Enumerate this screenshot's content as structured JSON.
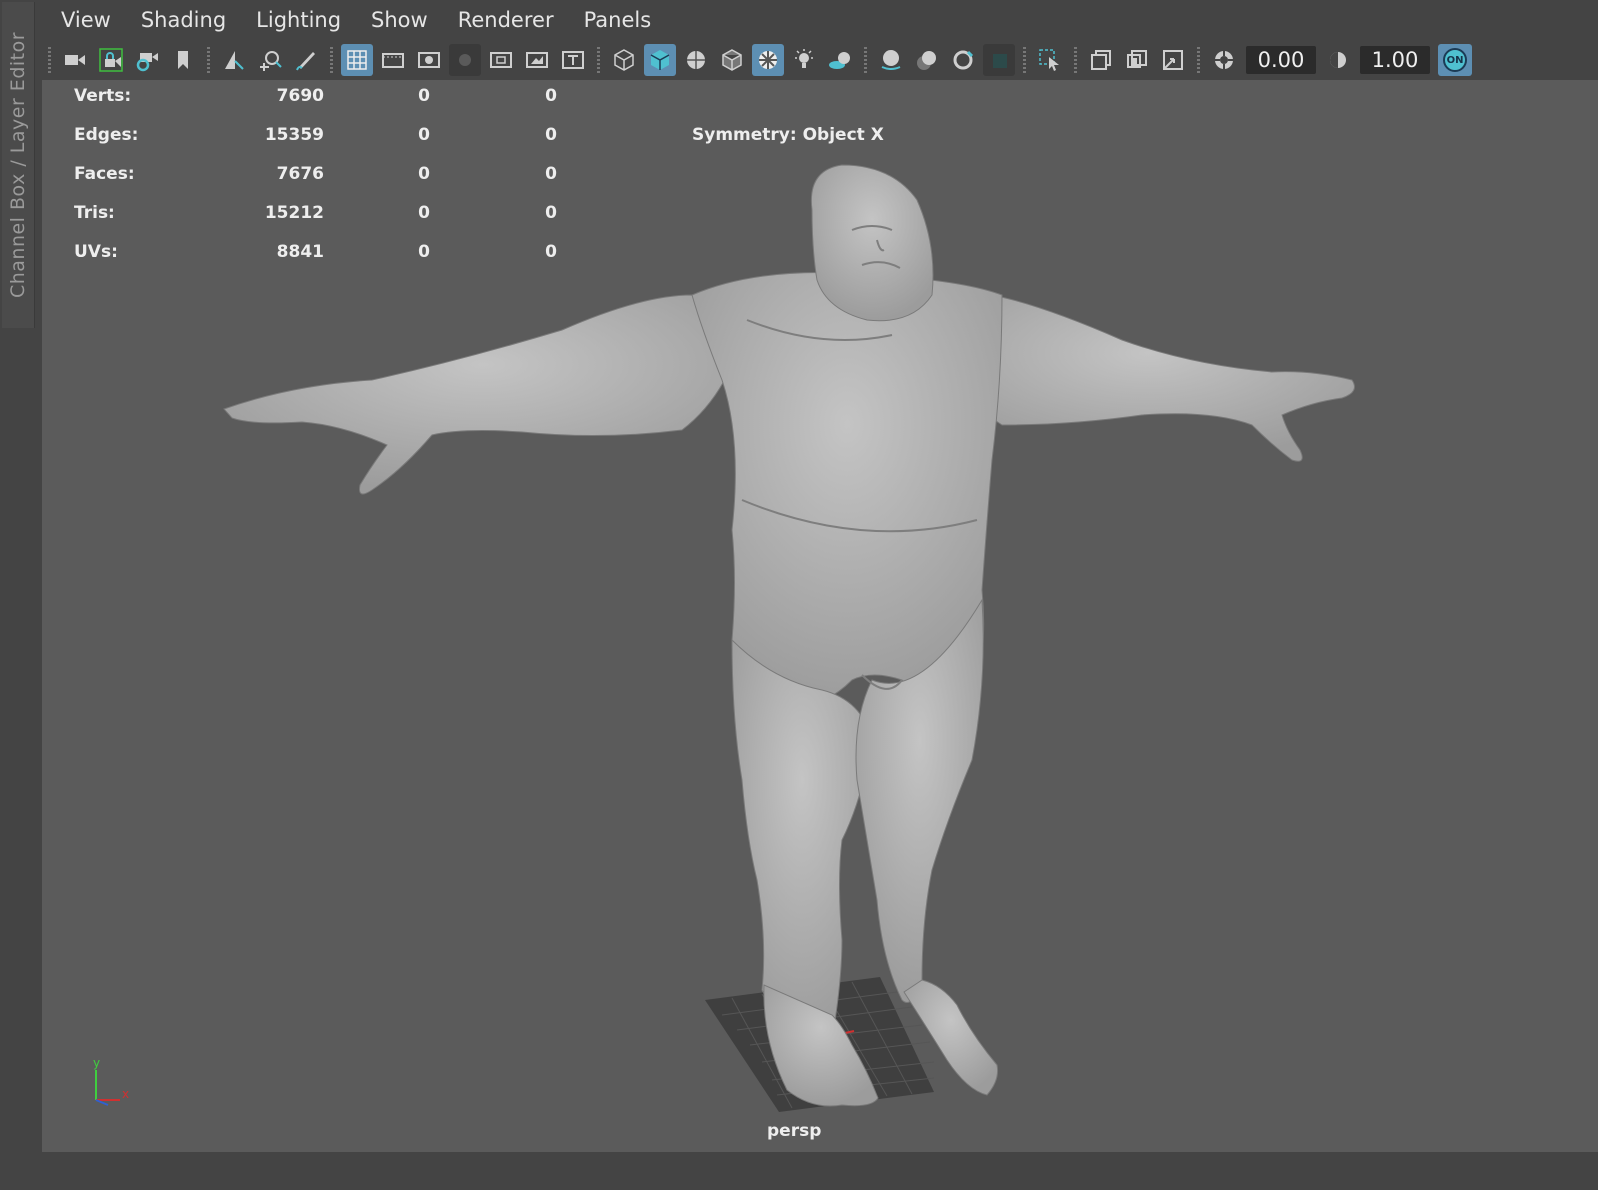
{
  "side_panel": {
    "tab_label": "Channel Box / Layer Editor"
  },
  "menubar": {
    "items": [
      "View",
      "Shading",
      "Lighting",
      "Show",
      "Renderer",
      "Panels"
    ]
  },
  "toolbar": {
    "exposure_value": "0.00",
    "gamma_value": "1.00",
    "color_management_toggle": "ON",
    "icons": [
      "select-camera-icon",
      "lock-camera-icon",
      "camera-attributes-icon",
      "bookmark-icon",
      "image-plane-icon",
      "2d-pan-zoom-icon",
      "grease-pencil-icon",
      "grid-icon",
      "film-gate-icon",
      "resolution-gate-icon",
      "gate-mask-icon",
      "field-chart-icon",
      "safe-action-icon",
      "safe-title-icon",
      "wireframe-icon",
      "smooth-shade-icon",
      "wireframe-on-shaded-icon",
      "textured-icon",
      "use-all-lights-icon",
      "shadows-icon",
      "screen-space-ao-icon",
      "motion-blur-icon",
      "anti-aliasing-icon",
      "depth-of-field-icon",
      "isolate-select-icon",
      "xray-icon",
      "xray-active-components-icon",
      "xray-joints-icon",
      "exposure-icon",
      "gamma-icon"
    ]
  },
  "hud": {
    "rows": [
      {
        "label": "Verts:",
        "v1": "7690",
        "v2": "0",
        "v3": "0"
      },
      {
        "label": "Edges:",
        "v1": "15359",
        "v2": "0",
        "v3": "0"
      },
      {
        "label": "Faces:",
        "v1": "7676",
        "v2": "0",
        "v3": "0"
      },
      {
        "label": "Tris:",
        "v1": "15212",
        "v2": "0",
        "v3": "0"
      },
      {
        "label": "UVs:",
        "v1": "8841",
        "v2": "0",
        "v3": "0"
      }
    ],
    "symmetry": "Symmetry: Object X"
  },
  "viewport": {
    "camera": "persp",
    "axis_labels": {
      "y": "y",
      "x": "x"
    },
    "colors": {
      "background": "#5b5b5b",
      "model": "#b4b4b4",
      "accent": "#5d8fb3"
    }
  }
}
